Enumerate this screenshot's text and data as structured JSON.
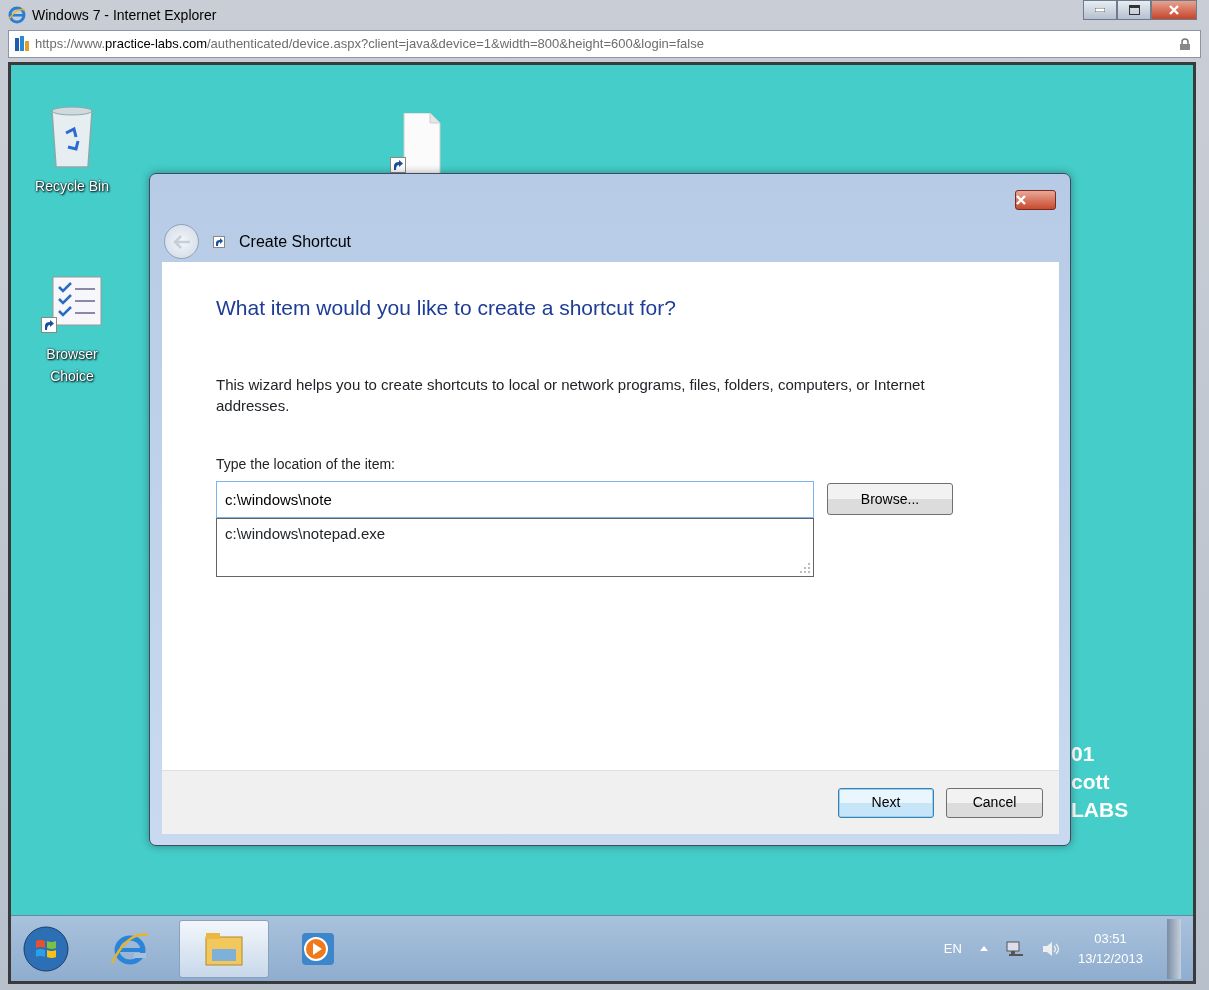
{
  "window": {
    "title": "Windows 7 - Internet Explorer"
  },
  "address_bar": {
    "parts": [
      {
        "text": "https://",
        "emphasis": false
      },
      {
        "text": "www.",
        "emphasis": false
      },
      {
        "text": "practice-labs.com",
        "emphasis": true
      },
      {
        "text": "/authenticated/device.aspx?client=java&device=1&width=800&height=600&login=false",
        "emphasis": false
      }
    ]
  },
  "desktop": {
    "icons": [
      {
        "kind": "recycle",
        "label_lines": [
          "Recycle Bin"
        ]
      },
      {
        "kind": "checklist",
        "label_lines": [
          "Browser",
          "Choice"
        ]
      },
      {
        "kind": "file"
      }
    ],
    "wallpaper_text": [
      "01",
      "cott",
      "LABS"
    ]
  },
  "dialog": {
    "title": "Create Shortcut",
    "back_disabled": true,
    "heading": "What item would you like to create a shortcut for?",
    "description": "This wizard helps you to create shortcuts to local or network programs, files, folders, computers, or Internet addresses.",
    "location_label": "Type the location of the item:",
    "location_value": "c:\\windows\\note",
    "suggestions": [
      "c:\\windows\\notepad.exe"
    ],
    "browse_button": "Browse...",
    "buttons": [
      {
        "label": "Next",
        "default": true
      },
      {
        "label": "Cancel",
        "default": false
      }
    ]
  },
  "taskbar": {
    "items": [
      {
        "kind": "ie",
        "selected": false
      },
      {
        "kind": "explorer",
        "selected": true
      },
      {
        "kind": "media",
        "selected": false
      }
    ],
    "tray": {
      "language": "EN",
      "time": "03:51",
      "date": "13/12/2013"
    }
  }
}
